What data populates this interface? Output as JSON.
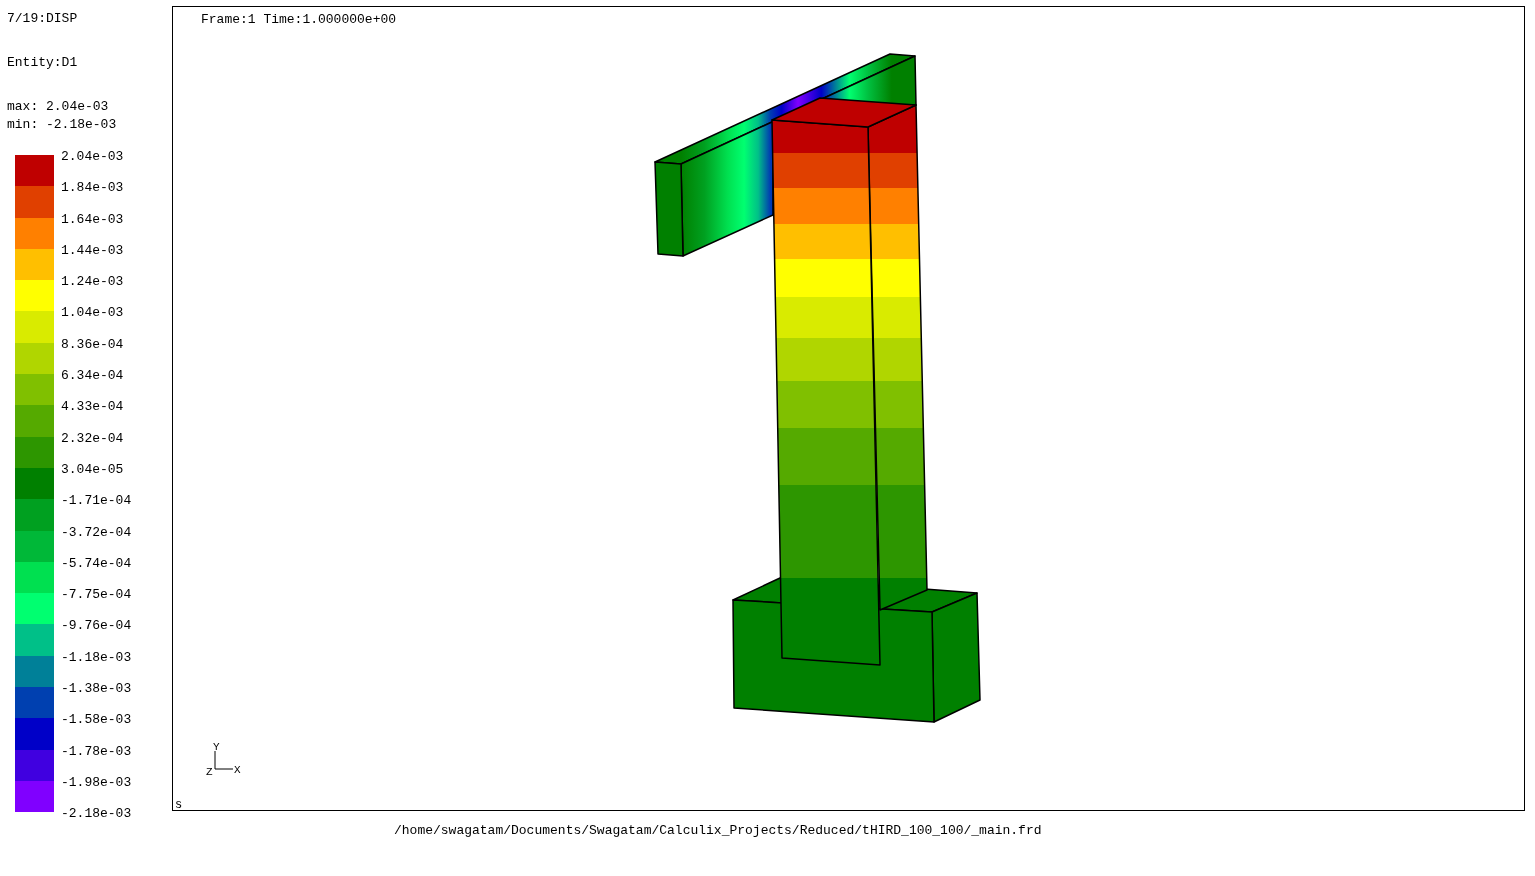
{
  "info": {
    "dataset": "7/19:DISP",
    "entity": "Entity:D1",
    "max": "max: 2.04e-03",
    "min": "min: -2.18e-03"
  },
  "legend": {
    "bands": [
      {
        "color": "#bf0000"
      },
      {
        "color": "#e04000"
      },
      {
        "color": "#ff8000"
      },
      {
        "color": "#ffbf00"
      },
      {
        "color": "#ffff00"
      },
      {
        "color": "#d9eb00"
      },
      {
        "color": "#b0d600"
      },
      {
        "color": "#80c000"
      },
      {
        "color": "#55aa00"
      },
      {
        "color": "#2d9600"
      },
      {
        "color": "#008000"
      },
      {
        "color": "#00a020"
      },
      {
        "color": "#00b838"
      },
      {
        "color": "#00e050"
      },
      {
        "color": "#00ff70"
      },
      {
        "color": "#00c088"
      },
      {
        "color": "#008098"
      },
      {
        "color": "#0040b0"
      },
      {
        "color": "#0000c8"
      },
      {
        "color": "#4000e0"
      },
      {
        "color": "#8000ff"
      }
    ],
    "labels": [
      "2.04e-03",
      "1.84e-03",
      "1.64e-03",
      "1.44e-03",
      "1.24e-03",
      "1.04e-03",
      "8.36e-04",
      "6.34e-04",
      "4.33e-04",
      "2.32e-04",
      "3.04e-05",
      "-1.71e-04",
      "-3.72e-04",
      "-5.74e-04",
      "-7.75e-04",
      "-9.76e-04",
      "-1.18e-03",
      "-1.38e-03",
      "-1.58e-03",
      "-1.78e-03",
      "-1.98e-03",
      "-2.18e-03"
    ]
  },
  "viewport": {
    "frame_info": "Frame:1 Time:1.000000e+00",
    "axes": {
      "x": "X",
      "y": "Y",
      "z": "Z"
    },
    "corner_mark": "s"
  },
  "file_path": "/home/swagatam/Documents/Swagatam/Calculix_Projects/Reduced/tHIRD_100_100/_main.frd"
}
